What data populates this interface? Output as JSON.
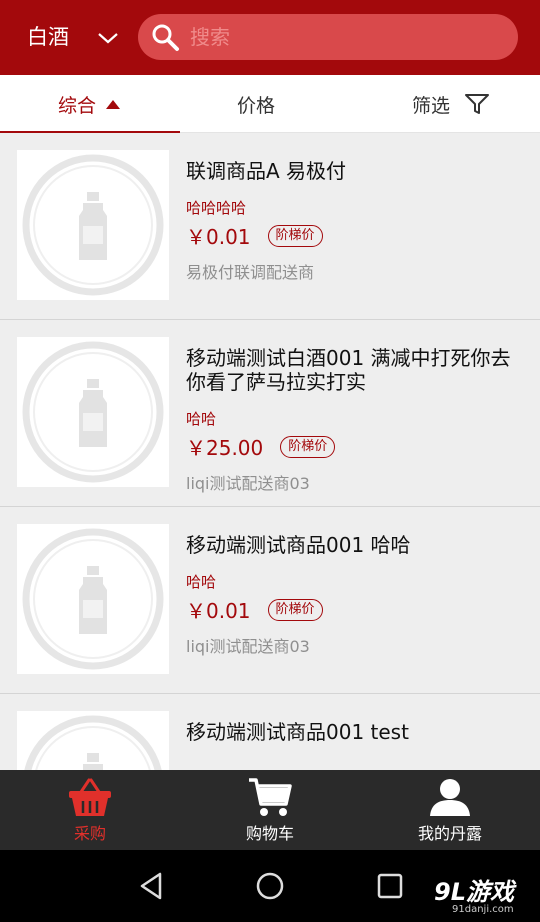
{
  "header": {
    "category": "白酒",
    "search_placeholder": "搜索"
  },
  "sort_tabs": [
    {
      "label": "综合",
      "active": true
    },
    {
      "label": "价格",
      "active": false
    },
    {
      "label": "筛选",
      "active": false
    }
  ],
  "products": [
    {
      "title": "联调商品A 易极付",
      "subtitle": "哈哈哈哈",
      "price": "￥0.01",
      "badge": "阶梯价",
      "vendor": "易极付联调配送商"
    },
    {
      "title": "移动端测试白酒001 满减中打死你去你看了萨马拉实打实",
      "subtitle": "哈哈",
      "price": "￥25.00",
      "badge": "阶梯价",
      "vendor": "liqi测试配送商03"
    },
    {
      "title": "移动端测试商品001 哈哈",
      "subtitle": "哈哈",
      "price": "￥0.01",
      "badge": "阶梯价",
      "vendor": "liqi测试配送商03"
    },
    {
      "title": "移动端测试商品001 test"
    }
  ],
  "bottom_nav": [
    {
      "label": "采购",
      "icon": "basket-icon",
      "active": true
    },
    {
      "label": "购物车",
      "icon": "cart-icon",
      "active": false
    },
    {
      "label": "我的丹露",
      "icon": "person-icon",
      "active": false
    }
  ],
  "watermark": {
    "main": "9L游戏",
    "sub": "91danji.com"
  },
  "colors": {
    "brand": "#a3090c",
    "search_bg": "#d9494b",
    "nav_bg": "#2a2a2a",
    "active_nav": "#e0302b"
  }
}
